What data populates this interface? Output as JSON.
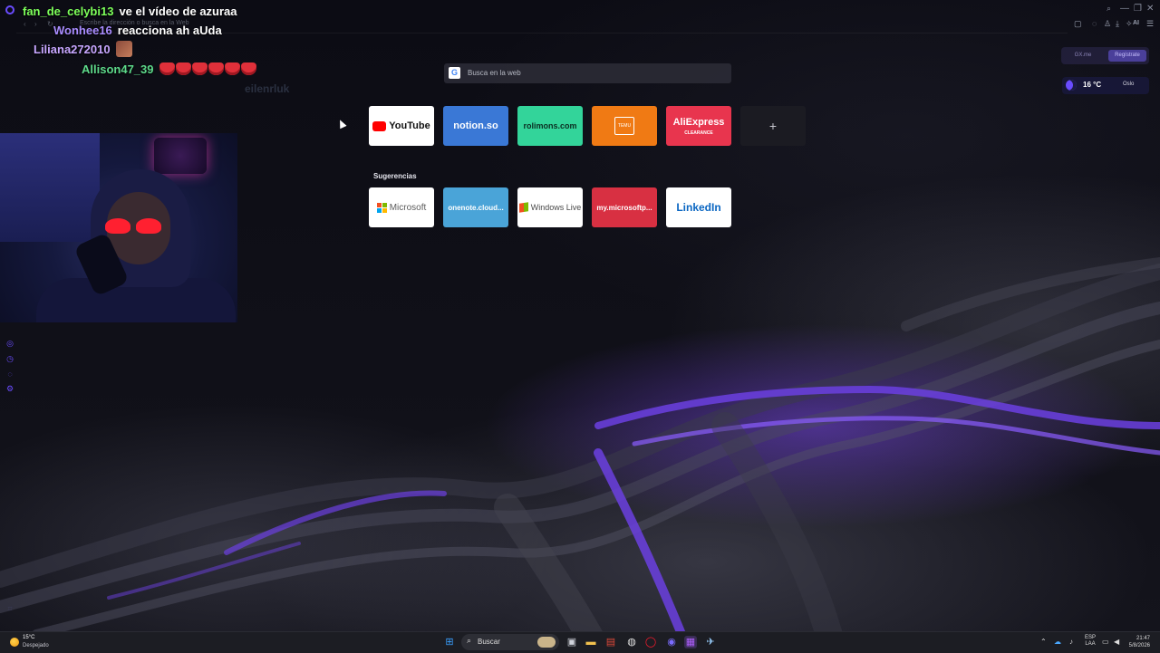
{
  "browser": {
    "address_text": "Escribe la dirección o busca en la Web",
    "ai_label": "AI",
    "window_controls": [
      "—",
      "❐",
      "✕"
    ]
  },
  "chat": [
    {
      "user": "fan_de_celybi13",
      "color": "#7dff5a",
      "message": "ve el vídeo de azuraa",
      "emote": ""
    },
    {
      "user": "Wonhee16",
      "color": "#a98cff",
      "message": "reacciona ah aUda",
      "emote": ""
    },
    {
      "user": "Liliana272010",
      "color": "#c7a6ff",
      "message": "",
      "emote": "image"
    },
    {
      "user": "Allison47_39",
      "color": "#5dd98a",
      "message": "",
      "emote": "hearts"
    }
  ],
  "ghost_text": "eilenrluk",
  "search": {
    "placeholder": "Busca en la web",
    "engine_icon": "google-icon"
  },
  "speed_dial": [
    {
      "label": "YouTube",
      "bg": "#ffffff",
      "fg": "#111111"
    },
    {
      "label": "notion.so",
      "bg": "#3a78d6",
      "fg": "#ffffff"
    },
    {
      "label": "rolimons.com",
      "bg": "#33d49a",
      "fg": "#0b2e22"
    },
    {
      "label": "TEMU",
      "bg": "#f07a14",
      "fg": "#ffffff"
    },
    {
      "label": "AliExpress",
      "bg": "#e8354e",
      "fg": "#ffffff",
      "sub": "CLEARANCE"
    },
    {
      "label": "+",
      "bg": "#1b1b22",
      "fg": "#c8c8d0"
    }
  ],
  "suggestions_label": "Sugerencias",
  "suggestions": [
    {
      "label": "Microsoft",
      "bg": "#ffffff",
      "fg": "#5b5b5b"
    },
    {
      "label": "onenote.cloud...",
      "bg": "#4aa4d8",
      "fg": "#ffffff"
    },
    {
      "label": "Windows Live",
      "bg": "#ffffff",
      "fg": "#4a4a4a"
    },
    {
      "label": "my.microsoftp...",
      "bg": "#d83042",
      "fg": "#ffffff"
    },
    {
      "label": "LinkedIn",
      "bg": "#ffffff",
      "fg": "#0a66c2"
    }
  ],
  "gx": {
    "left_label": "GX.me",
    "right_label": "Regístrate"
  },
  "weather_widget": {
    "temp": "16 °C",
    "city": "Oslo"
  },
  "taskbar": {
    "weather_temp": "15°C",
    "weather_cond": "Despejado",
    "search_label": "Buscar",
    "lang_line1": "ESP",
    "lang_line2": "LAA",
    "time": "21:47",
    "date": "5/8/2026"
  }
}
